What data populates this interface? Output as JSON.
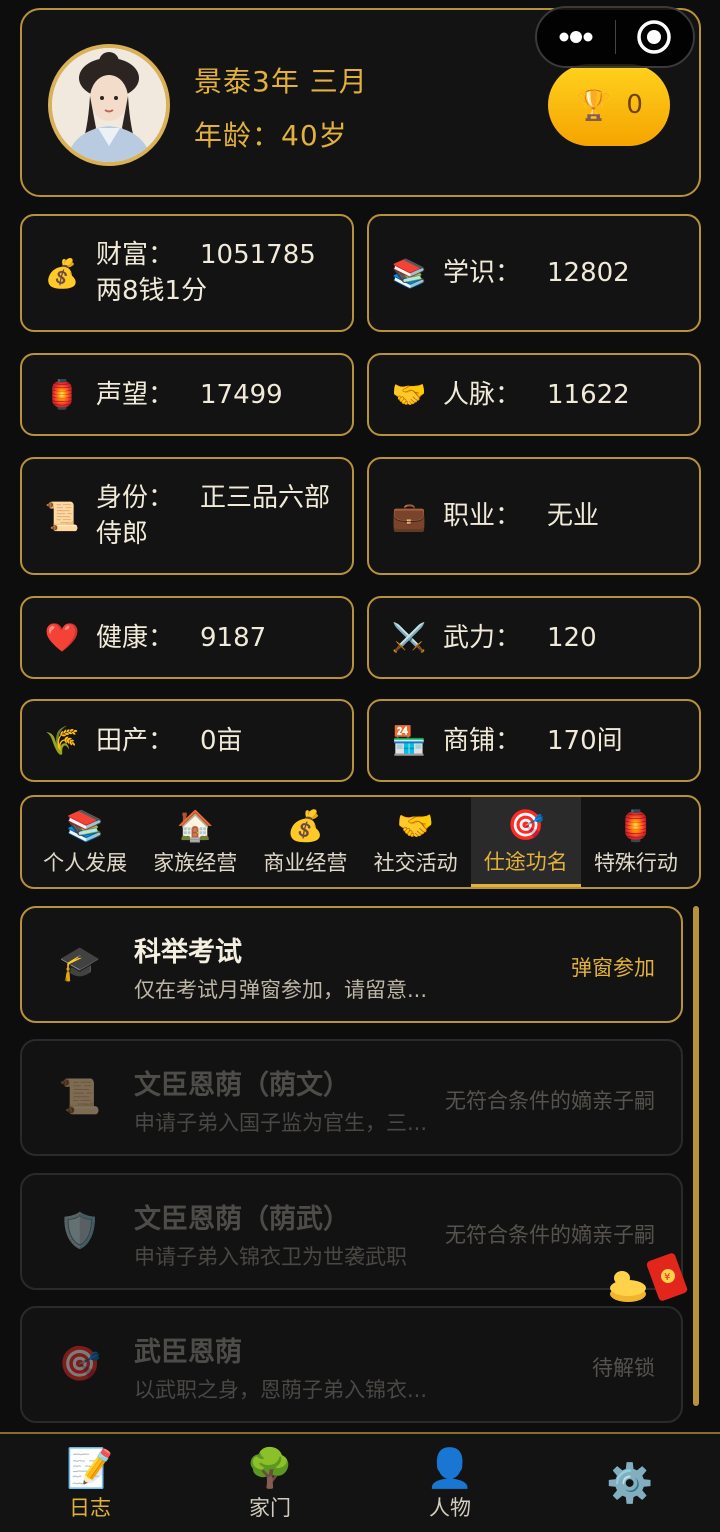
{
  "header": {
    "date": "景泰3年 三月",
    "age": "年龄：40岁",
    "trophy_icon": "🏆",
    "trophy_count": "0"
  },
  "stats": [
    {
      "icon": "💰",
      "label": "财富：",
      "value": "1051785两8钱1分"
    },
    {
      "icon": "📚",
      "label": "学识：",
      "value": "12802"
    },
    {
      "icon": "🏮",
      "label": "声望：",
      "value": "17499"
    },
    {
      "icon": "🤝",
      "label": "人脉：",
      "value": "11622"
    },
    {
      "icon": "📜",
      "label": "身份：",
      "value": "正三品六部侍郎"
    },
    {
      "icon": "💼",
      "label": "职业：",
      "value": "无业"
    },
    {
      "icon": "❤️",
      "label": "健康：",
      "value": "9187"
    },
    {
      "icon": "⚔️",
      "label": "武力：",
      "value": "120"
    },
    {
      "icon": "🌾",
      "label": "田产：",
      "value": "0亩"
    },
    {
      "icon": "🏪",
      "label": "商铺：",
      "value": "170间"
    }
  ],
  "tabs": [
    {
      "icon": "📚",
      "label": "个人发展"
    },
    {
      "icon": "🏠",
      "label": "家族经营"
    },
    {
      "icon": "💰",
      "label": "商业经营"
    },
    {
      "icon": "🤝",
      "label": "社交活动"
    },
    {
      "icon": "🎯",
      "label": "仕途功名"
    },
    {
      "icon": "🏮",
      "label": "特殊行动"
    }
  ],
  "actions": [
    {
      "icon": "🎓",
      "title": "科举考试",
      "subtitle": "仅在考试月弹窗参加，请留意...",
      "badge": "弹窗参加"
    },
    {
      "icon": "📜",
      "title": "文臣恩荫（荫文）",
      "subtitle": "申请子弟入国子监为官生，三...",
      "badge": "无符合条件的嫡亲子嗣"
    },
    {
      "icon": "🛡️",
      "title": "文臣恩荫（荫武）",
      "subtitle": "申请子弟入锦衣卫为世袭武职",
      "badge": "无符合条件的嫡亲子嗣"
    },
    {
      "icon": "🎯",
      "title": "武臣恩荫",
      "subtitle": "以武职之身，恩荫子弟入锦衣...",
      "badge": "待解锁"
    }
  ],
  "bottom_nav": [
    {
      "icon": "📝",
      "label": "日志"
    },
    {
      "icon": "🌳",
      "label": "家门"
    },
    {
      "icon": "👤",
      "label": "人物"
    },
    {
      "icon": "⚙️",
      "label": ""
    }
  ],
  "colors": {
    "accent": "#e2b13c",
    "border": "#b8923a",
    "background": "#0d0d0d"
  }
}
